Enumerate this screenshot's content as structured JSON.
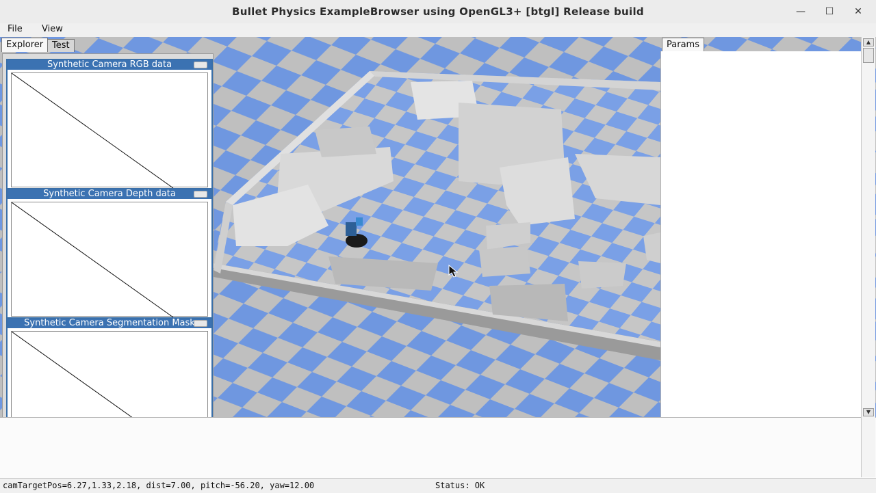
{
  "window": {
    "title": "Bullet Physics ExampleBrowser using OpenGL3+ [btgl] Release build",
    "minimize_glyph": "—",
    "maximize_glyph": "☐",
    "close_glyph": "✕"
  },
  "menu": {
    "file": "File",
    "view": "View"
  },
  "tabs": {
    "explorer": "Explorer",
    "test": "Test",
    "params": "Params"
  },
  "camera_windows": [
    {
      "title": "Synthetic Camera RGB data"
    },
    {
      "title": "Synthetic Camera Depth data"
    },
    {
      "title": "Synthetic Camera Segmentation Mask"
    }
  ],
  "status": {
    "camera": "camTargetPos=6.27,1.33,2.18, dist=7.00, pitch=-56.20, yaw=12.00",
    "state": "Status: OK"
  },
  "colors": {
    "floor_blue": "#6f97e0",
    "floor_gray": "#bfbfbf",
    "wall": "#dcdcdc",
    "title_blue": "#3b72b2"
  },
  "icons": {
    "scroll_up": "▲",
    "scroll_down": "▼"
  }
}
